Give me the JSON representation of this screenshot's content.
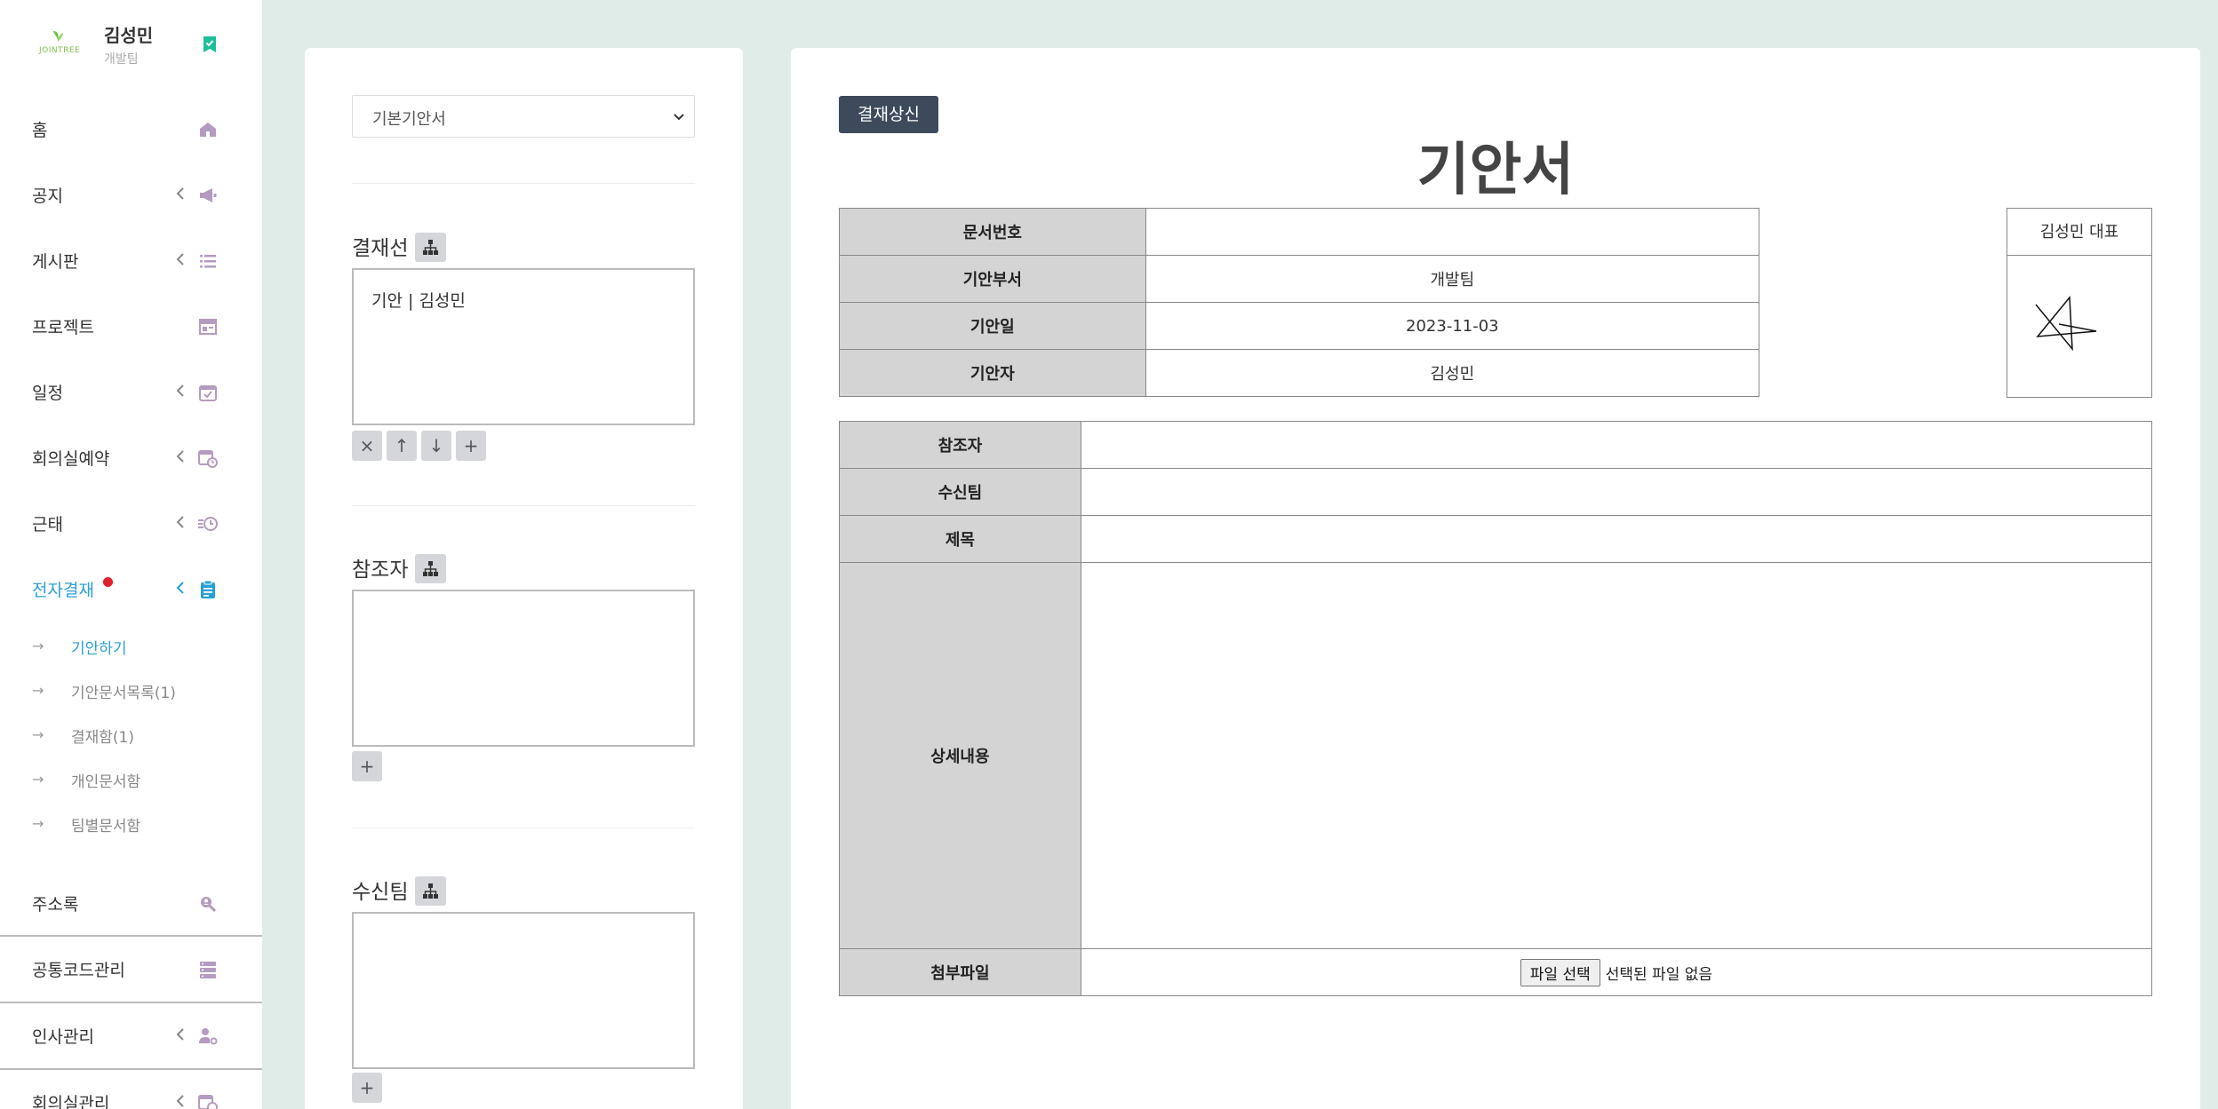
{
  "profile": {
    "logo_text": "JOINTREE",
    "name": "김성민",
    "team": "개발팀"
  },
  "colors": {
    "sidebar_active": "#2a9fd6",
    "icon_purple": "#b49bbf",
    "submit_bg": "#3d4a5c",
    "badge_green": "#1fbf9a",
    "header_cell_bg": "#d4d4d4",
    "page_bg": "#e0ece8"
  },
  "sidebar": {
    "items": [
      {
        "label": "홈",
        "icon": "home-icon",
        "chevron": false
      },
      {
        "label": "공지",
        "icon": "megaphone-icon",
        "chevron": true
      },
      {
        "label": "게시판",
        "icon": "list-icon",
        "chevron": true
      },
      {
        "label": "프로젝트",
        "icon": "layout-icon",
        "chevron": false
      },
      {
        "label": "일정",
        "icon": "calendar-check-icon",
        "chevron": true
      },
      {
        "label": "회의실예약",
        "icon": "calendar-clock-icon",
        "chevron": true
      },
      {
        "label": "근태",
        "icon": "history-icon",
        "chevron": true
      },
      {
        "label": "전자결재",
        "icon": "clipboard-icon",
        "chevron": true,
        "active": true
      }
    ],
    "submenu": [
      {
        "label": "기안하기",
        "active": true
      },
      {
        "label": "기안문서목록(1)"
      },
      {
        "label": "결재함(1)"
      },
      {
        "label": "개인문서함"
      },
      {
        "label": "팀별문서함"
      }
    ],
    "items_bottom": [
      {
        "label": "주소록",
        "icon": "search-person-icon",
        "chevron": false
      },
      {
        "label": "공통코드관리",
        "icon": "server-icon",
        "chevron": false
      },
      {
        "label": "인사관리",
        "icon": "user-gear-icon",
        "chevron": true
      },
      {
        "label": "회의실관리",
        "icon": "calendar-clock-icon",
        "chevron": true
      }
    ]
  },
  "form": {
    "template_select": "기본기안서",
    "approval_line": {
      "title": "결재선",
      "entries": [
        "기안 | 김성민"
      ],
      "buttons": [
        "×",
        "↑",
        "↓",
        "+"
      ]
    },
    "references": {
      "title": "참조자",
      "add": "+"
    },
    "receiving_team": {
      "title": "수신팀",
      "add": "+"
    }
  },
  "document": {
    "submit_label": "결재상신",
    "title": "기안서",
    "info_rows": [
      {
        "label": "문서번호",
        "value": ""
      },
      {
        "label": "기안부서",
        "value": "개발팀"
      },
      {
        "label": "기안일",
        "value": "2023-11-03"
      },
      {
        "label": "기안자",
        "value": "김성민"
      }
    ],
    "signer": "김성민 대표",
    "body_rows": {
      "ref_label": "참조자",
      "team_label": "수신팀",
      "subject_label": "제목",
      "detail_label": "상세내용",
      "attach_label": "첨부파일",
      "file_button": "파일 선택",
      "file_status": "선택된 파일 없음"
    }
  }
}
